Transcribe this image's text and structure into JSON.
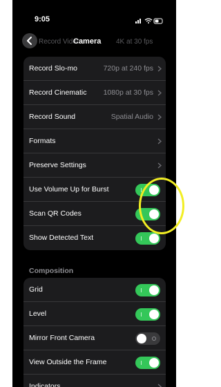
{
  "status": {
    "time": "9:05"
  },
  "nav": {
    "title": "Camera",
    "ghost_label": "Record Video",
    "ghost_value": "4K at 30 fps"
  },
  "group1": [
    {
      "label": "Record Slo-mo",
      "value": "720p at 240 fps",
      "type": "chevron"
    },
    {
      "label": "Record Cinematic",
      "value": "1080p at 30 fps",
      "type": "chevron"
    },
    {
      "label": "Record Sound",
      "value": "Spatial Audio",
      "type": "chevron"
    },
    {
      "label": "Formats",
      "value": "",
      "type": "chevron"
    },
    {
      "label": "Preserve Settings",
      "value": "",
      "type": "chevron"
    },
    {
      "label": "Use Volume Up for Burst",
      "type": "toggle",
      "on": true
    },
    {
      "label": "Scan QR Codes",
      "type": "toggle",
      "on": true
    },
    {
      "label": "Show Detected Text",
      "type": "toggle",
      "on": true
    }
  ],
  "section_composition": "Composition",
  "group2": [
    {
      "label": "Grid",
      "type": "toggle",
      "on": true
    },
    {
      "label": "Level",
      "type": "toggle",
      "on": true
    },
    {
      "label": "Mirror Front Camera",
      "type": "toggle",
      "on": false
    },
    {
      "label": "View Outside the Frame",
      "type": "toggle",
      "on": true
    },
    {
      "label": "Indicators",
      "value": "",
      "type": "chevron"
    }
  ],
  "colors": {
    "accent_green": "#34c759",
    "highlight_yellow": "#f2ee23",
    "cell": "#1c1c1e"
  }
}
